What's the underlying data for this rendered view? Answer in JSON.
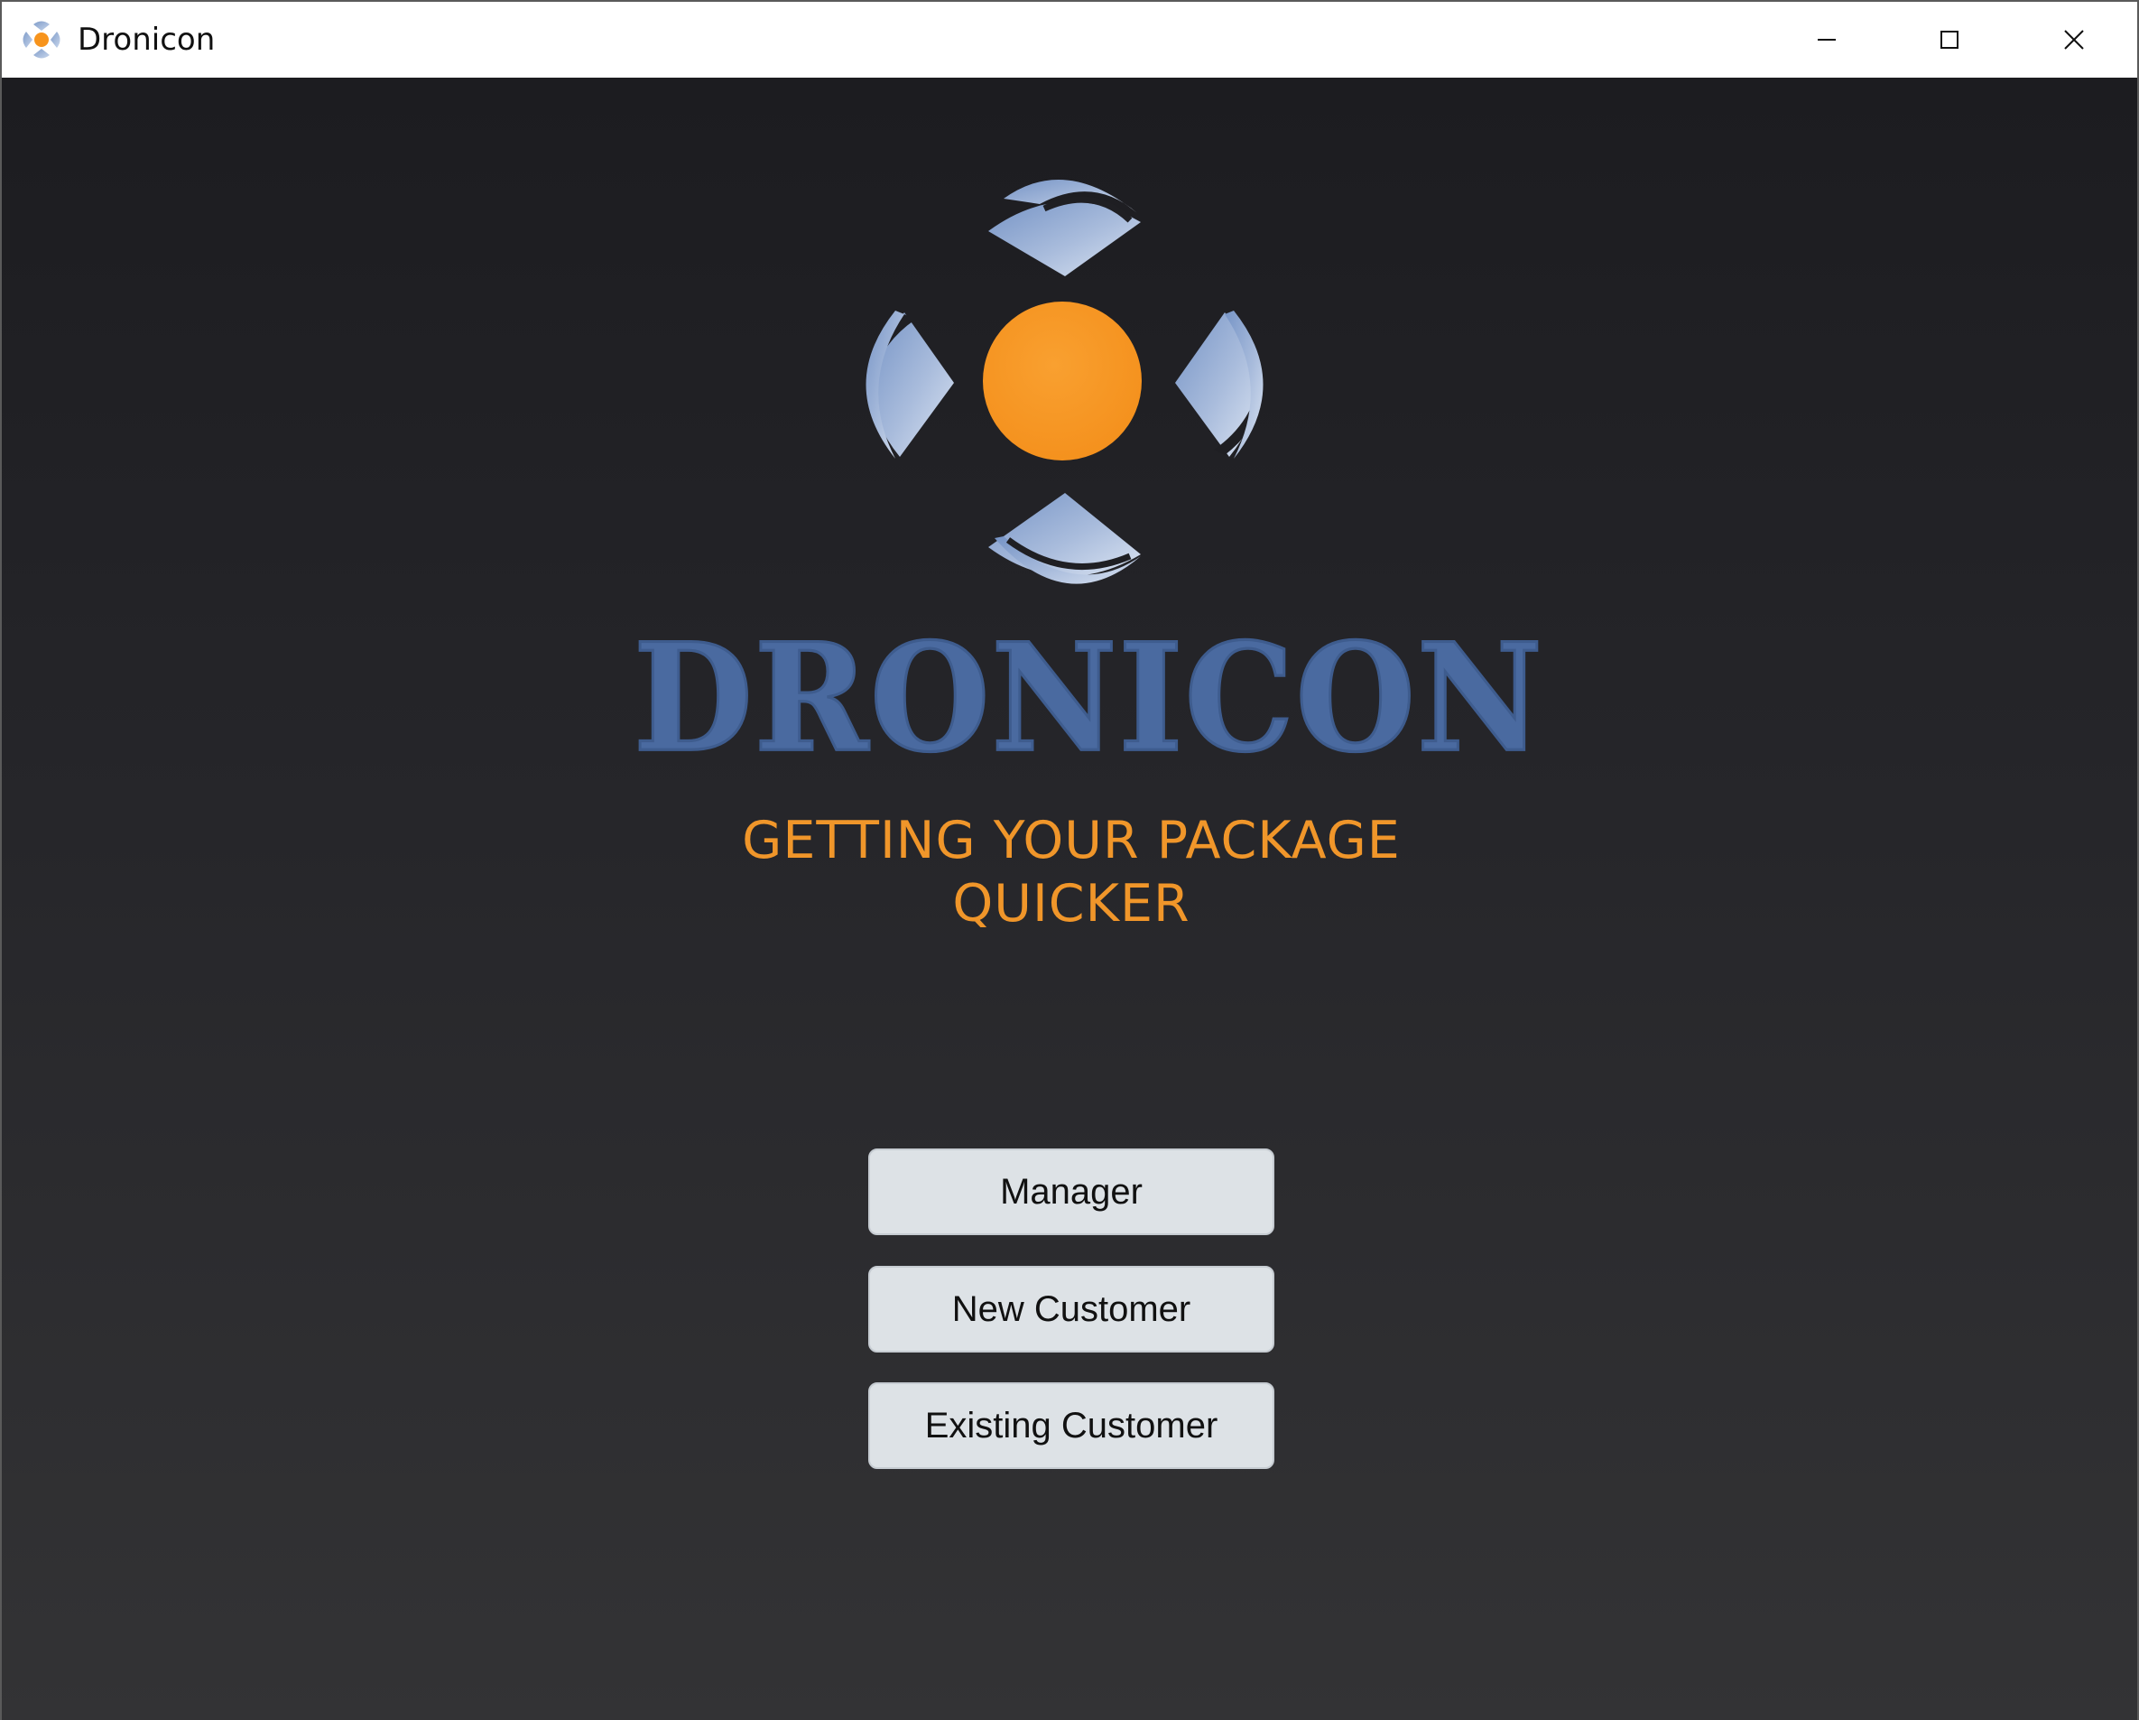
{
  "window": {
    "title": "Dronicon",
    "app_icon": "dronicon-logo-icon",
    "controls": {
      "minimize_icon": "minimize-icon",
      "maximize_icon": "maximize-icon",
      "close_icon": "close-icon"
    }
  },
  "splash": {
    "logo_icon": "dronicon-drone-logo",
    "brand_name": "DRONICON",
    "tagline": "GETTING YOUR PACKAGE QUICKER"
  },
  "menu": {
    "manager_label": "Manager",
    "new_customer_label": "New Customer",
    "existing_customer_label": "Existing Customer"
  },
  "colors": {
    "brand_blue": "#4a6aa0",
    "accent_orange": "#f7941d",
    "button_bg": "#dde2e6",
    "background_top": "#1c1c20",
    "background_bottom": "#333335"
  }
}
